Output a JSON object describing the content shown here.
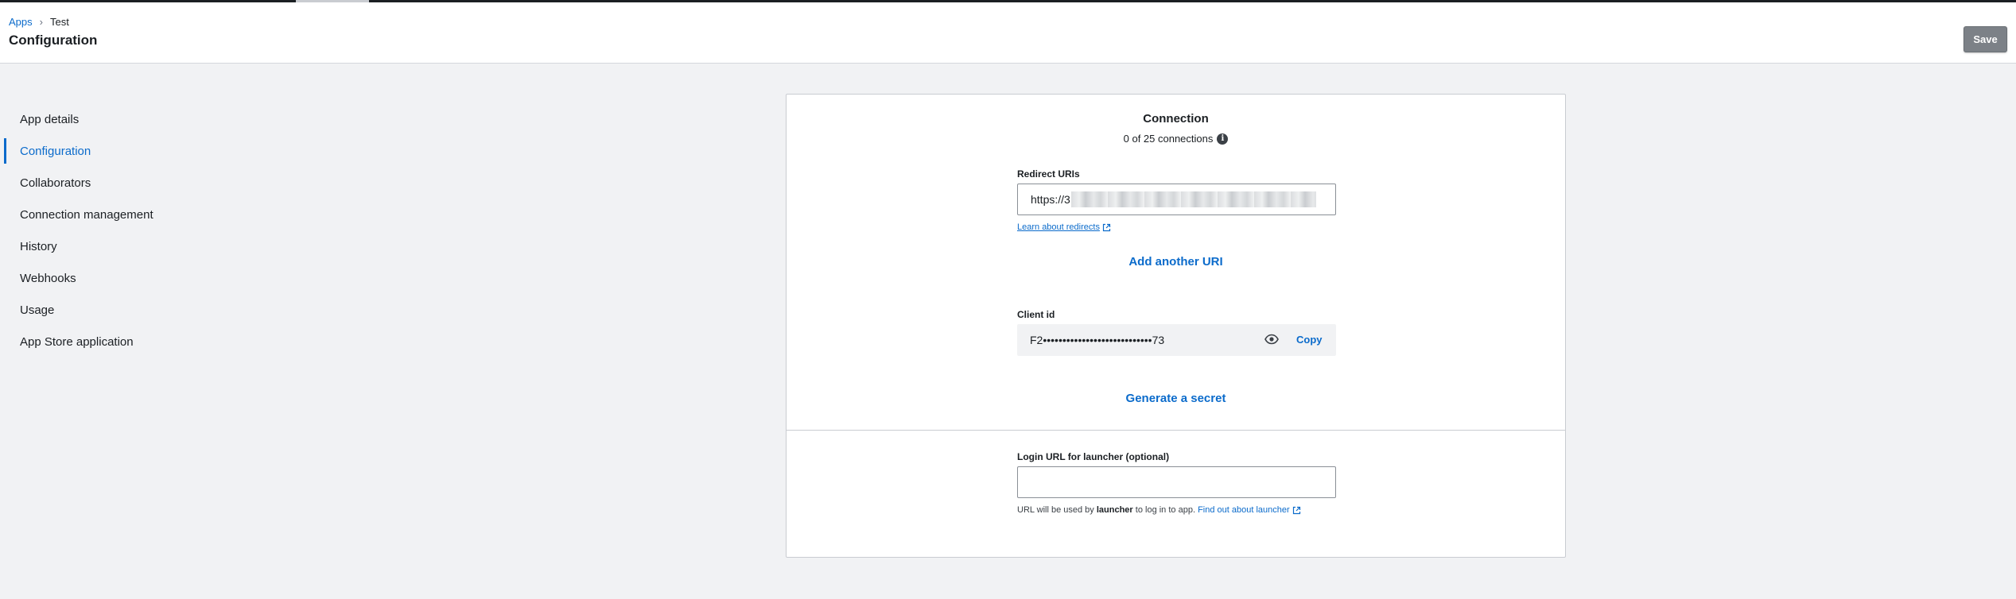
{
  "breadcrumb": {
    "root": "Apps",
    "separator": "›",
    "current": "Test"
  },
  "page": {
    "title": "Configuration"
  },
  "toolbar": {
    "save_label": "Save"
  },
  "sidebar": {
    "items": [
      {
        "label": "App details",
        "active": false
      },
      {
        "label": "Configuration",
        "active": true
      },
      {
        "label": "Collaborators",
        "active": false
      },
      {
        "label": "Connection management",
        "active": false
      },
      {
        "label": "History",
        "active": false
      },
      {
        "label": "Webhooks",
        "active": false
      },
      {
        "label": "Usage",
        "active": false
      },
      {
        "label": "App Store application",
        "active": false
      }
    ]
  },
  "connection": {
    "title": "Connection",
    "count_text": "0 of 25 connections",
    "count_icon": "info-icon",
    "redirect_label": "Redirect URIs",
    "redirect_value": "https://3",
    "learn_link": "Learn about redirects",
    "add_uri": "Add another URI",
    "client_label": "Client id",
    "client_value": "F2••••••••••••••••••••••••••••73",
    "reveal_icon": "eye-icon",
    "copy_label": "Copy",
    "generate_secret": "Generate a secret"
  },
  "launcher": {
    "label": "Login URL for launcher (optional)",
    "value": "",
    "help_prefix": "URL will be used by ",
    "help_bold": "launcher",
    "help_suffix": " to log in to app. ",
    "help_link": "Find out about launcher"
  },
  "colors": {
    "accent": "#0b6bcb",
    "save_button": "#7c8187",
    "background": "#f1f2f4"
  }
}
